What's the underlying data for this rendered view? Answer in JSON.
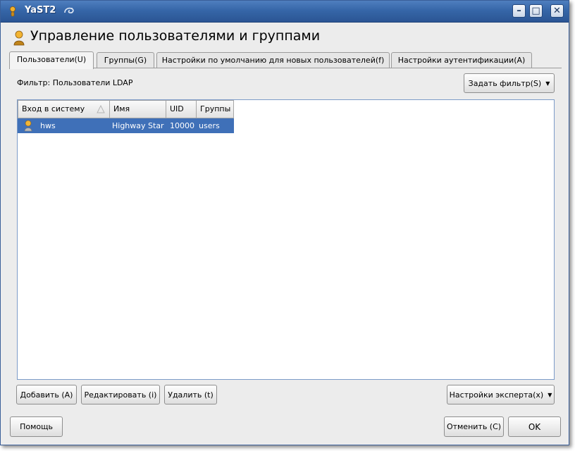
{
  "window": {
    "title": "YaST2",
    "controls": {
      "minimize": "–",
      "maximize": "□",
      "close": "✕"
    }
  },
  "header": {
    "title": "Управление пользователями и группами"
  },
  "tabs": [
    {
      "label": "Пользователи(U)",
      "active": true
    },
    {
      "label": "Группы(G)",
      "active": false
    },
    {
      "label": "Настройки по умолчанию для новых пользователей(f)",
      "active": false
    },
    {
      "label": "Настройки аутентификации(A)",
      "active": false
    }
  ],
  "filter": {
    "label": "Фильтр: Пользователи LDAP",
    "button": "Задать фильтр(S)"
  },
  "table": {
    "columns": [
      "Вход в систему",
      "Имя",
      "UID",
      "Группы"
    ],
    "rows": [
      {
        "login": "hws",
        "name": "Highway Star",
        "uid": "10000",
        "groups": "users",
        "selected": true
      }
    ]
  },
  "actions": {
    "add": "Добавить (A)",
    "edit": "Редактировать (i)",
    "delete": "Удалить (t)",
    "expert": "Настройки эксперта(x)"
  },
  "footer": {
    "help": "Помощь",
    "cancel": "Отменить (C)",
    "ok": "OK"
  },
  "colors": {
    "titlebar": "#3666a8",
    "selection": "#3f70b8",
    "background": "#ececec"
  },
  "icons": {
    "app": "user-icon",
    "sort": "sort-ascending-icon",
    "row": "user-icon"
  }
}
